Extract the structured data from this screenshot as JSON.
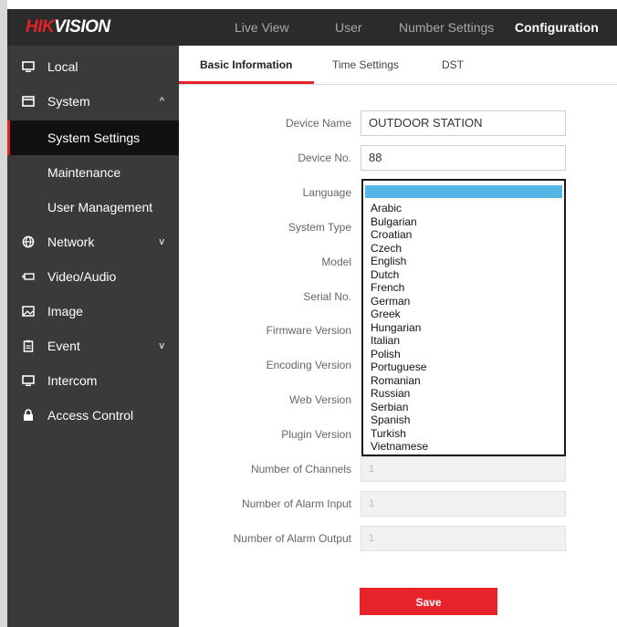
{
  "brand": {
    "logo_red": "HIK",
    "logo_white": "VISION"
  },
  "topnav": [
    {
      "label": "Live View"
    },
    {
      "label": "User"
    },
    {
      "label": "Number Settings"
    },
    {
      "label": "Configuration",
      "active": true
    }
  ],
  "sidebar": {
    "items": [
      {
        "label": "Local",
        "icon": "monitor-icon"
      },
      {
        "label": "System",
        "icon": "window-icon",
        "expanded": true,
        "chevron": "^"
      },
      {
        "label": "System Settings",
        "selected": true
      },
      {
        "label": "Maintenance"
      },
      {
        "label": "User Management"
      },
      {
        "label": "Network",
        "icon": "globe-icon",
        "chevron": "v"
      },
      {
        "label": "Video/Audio",
        "icon": "camera-icon"
      },
      {
        "label": "Image",
        "icon": "image-icon"
      },
      {
        "label": "Event",
        "icon": "clipboard-icon",
        "chevron": "v"
      },
      {
        "label": "Intercom",
        "icon": "monitor-icon"
      },
      {
        "label": "Access Control",
        "icon": "lock-icon"
      }
    ]
  },
  "tabs": [
    {
      "label": "Basic Information",
      "active": true
    },
    {
      "label": "Time Settings"
    },
    {
      "label": "DST"
    }
  ],
  "form": {
    "device_name": {
      "label": "Device Name",
      "value": "OUTDOOR STATION"
    },
    "device_no": {
      "label": "Device No.",
      "value": "88"
    },
    "language": {
      "label": "Language",
      "options": [
        "Arabic",
        "Bulgarian",
        "Croatian",
        "Czech",
        "English",
        "Dutch",
        "French",
        "German",
        "Greek",
        "Hungarian",
        "Italian",
        "Polish",
        "Portuguese",
        "Romanian",
        "Russian",
        "Serbian",
        "Spanish",
        "Turkish",
        "Vietnamese"
      ]
    },
    "system_type": {
      "label": "System Type"
    },
    "model": {
      "label": "Model"
    },
    "serial_no": {
      "label": "Serial No."
    },
    "firmware_version": {
      "label": "Firmware Version"
    },
    "encoding_version": {
      "label": "Encoding Version"
    },
    "web_version": {
      "label": "Web Version"
    },
    "plugin_version": {
      "label": "Plugin Version"
    },
    "channels": {
      "label": "Number of Channels",
      "value": "1"
    },
    "alarm_input": {
      "label": "Number of Alarm Input",
      "value": "1"
    },
    "alarm_output": {
      "label": "Number of Alarm Output",
      "value": "1"
    }
  },
  "save_label": "Save",
  "colors": {
    "accent": "#e8242a",
    "sidebar": "#3a3a3a",
    "topbar": "#2b2b2b",
    "highlight": "#55b6e6"
  }
}
